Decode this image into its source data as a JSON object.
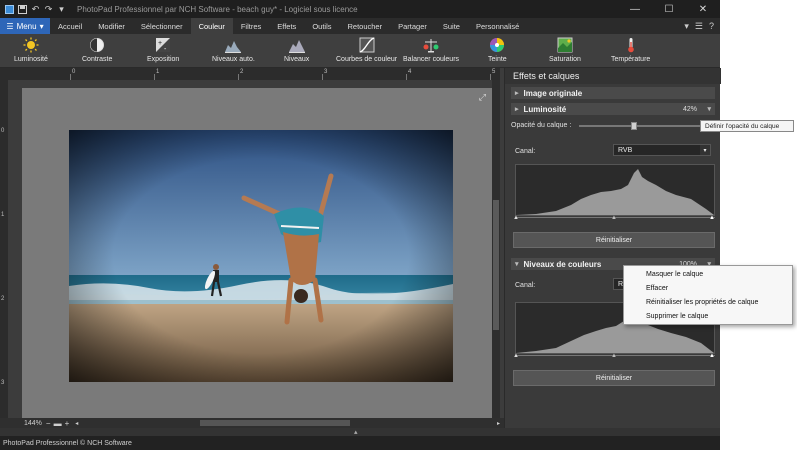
{
  "window": {
    "title": "PhotoPad Professionnel par NCH Software - beach guy* - Logiciel sous licence",
    "controls": [
      "minimize",
      "maximize",
      "close"
    ]
  },
  "quick_access": [
    "save-icon",
    "undo-icon",
    "redo-icon",
    "more-icon"
  ],
  "menu_button": "Menu",
  "tabs": [
    "Accueil",
    "Modifier",
    "Sélectionner",
    "Couleur",
    "Filtres",
    "Effets",
    "Outils",
    "Retoucher",
    "Partager",
    "Suite",
    "Personnalisé"
  ],
  "active_tab": "Couleur",
  "ribbon": [
    {
      "label": "Luminosité",
      "icon": "sun-icon"
    },
    {
      "label": "Contraste",
      "icon": "contrast-icon"
    },
    {
      "label": "Exposition",
      "icon": "exposure-icon"
    },
    {
      "label": "Niveaux auto.",
      "icon": "auto-levels-icon"
    },
    {
      "label": "Niveaux",
      "icon": "levels-icon"
    },
    {
      "label": "Courbes de couleur",
      "icon": "curves-icon"
    },
    {
      "label": "Balancer couleurs",
      "icon": "balance-icon"
    },
    {
      "label": "Teinte",
      "icon": "hue-wheel-icon"
    },
    {
      "label": "Saturation",
      "icon": "saturation-icon"
    },
    {
      "label": "Température",
      "icon": "thermometer-icon"
    }
  ],
  "ruler": {
    "h_numbers": [
      "0",
      "1",
      "2",
      "3",
      "4",
      "5"
    ],
    "v_numbers": [
      "0",
      "1",
      "2",
      "3"
    ]
  },
  "zoom": "144%",
  "status": "PhotoPad Professionnel © NCH Software",
  "panel": {
    "title": "Effets et calques",
    "layer_original": "Image originale",
    "layer_brightness": "Luminosité",
    "brightness_pct": "42%",
    "opacity_label": "Opacité du calque :",
    "opacity_value": 0.42,
    "tooltip": "Définir l'opacité du calque",
    "channel_label": "Canal:",
    "channel_value": "RVB",
    "reset_label": "Réinitialiser",
    "layer_levels": "Niveaux de couleurs",
    "levels_pct": "100%",
    "channel_label_2": "Canal:",
    "channel_value_2": "RV",
    "reset_label_2": "Réinitialiser"
  },
  "context_menu": [
    "Masquer le calque",
    "Effacer",
    "Réinitialiser les propriétés de calque",
    "Supprimer le calque"
  ],
  "colors": {
    "accent": "#2e66b8",
    "panel_bg": "#3a3a3a",
    "canvas_bg": "#7a7a7a"
  }
}
